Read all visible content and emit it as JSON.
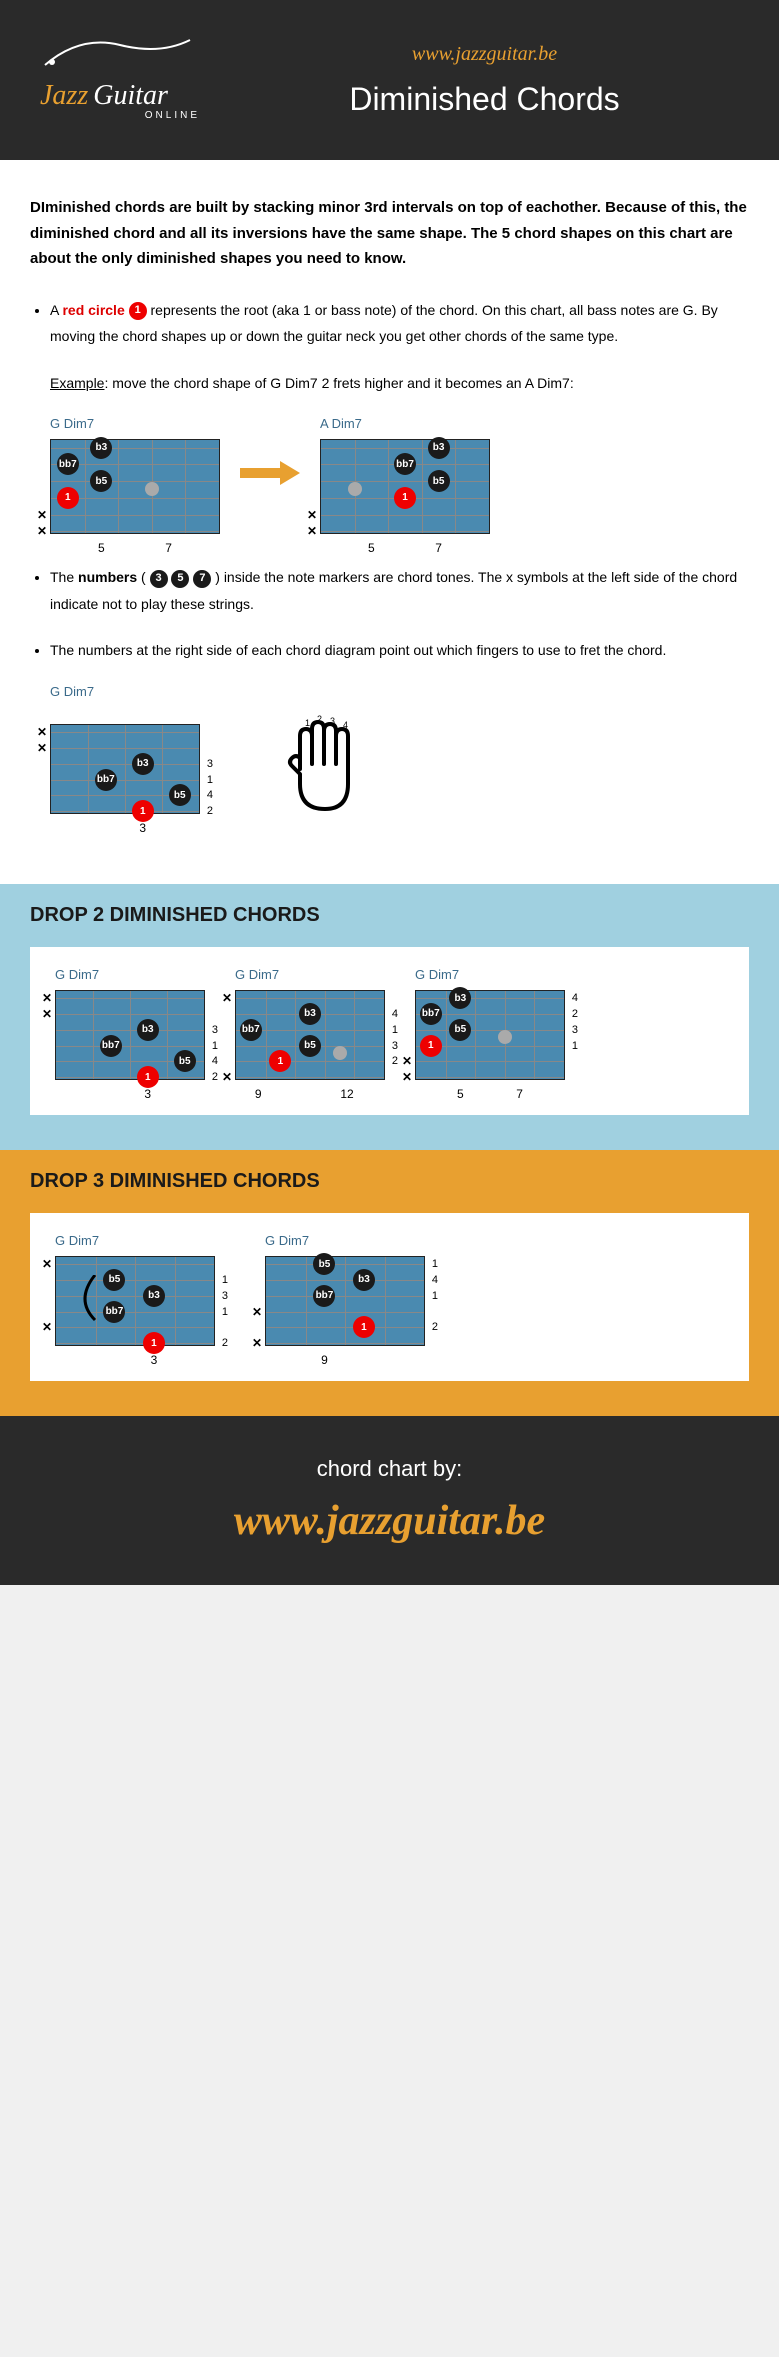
{
  "header": {
    "url": "www.jazzguitar.be",
    "title": "Diminished Chords",
    "logo_jazz": "Jazz",
    "logo_guitar": "Guitar",
    "logo_sub": "ONLINE"
  },
  "intro": "DIminished chords are built by stacking minor 3rd intervals on top of eachother. Because of this, the diminished chord and all its inversions have the same shape. The 5 chord shapes on this chart are about the only diminished shapes you need to know.",
  "bullet1_a": "A ",
  "bullet1_red": "red circle",
  "bullet1_b": " represents the root (aka 1 or bass note) of the chord. On this chart, all bass notes are G. By moving the chord shapes up or down the guitar neck you get other chords of the same type.",
  "example_label": "Example",
  "example_text": ": move the chord shape of G Dim7 2 frets higher and it becomes an A Dim7:",
  "diagram1_label": "G Dim7",
  "diagram2_label": "A Dim7",
  "bullet2_a": "The ",
  "bullet2_bold": "numbers",
  "bullet2_b": " ( ",
  "bullet2_c": " ) inside the note markers are chord tones. The x symbols at the left side of the chord indicate not to play these strings.",
  "bullet3": "The numbers at the right side of each chord diagram point out which fingers to use to fret the chord.",
  "diagram3_label": "G Dim7",
  "section1_title": "DROP 2 DIMINISHED CHORDS",
  "section1_chords": [
    "G Dim7",
    "G Dim7",
    "G Dim7"
  ],
  "section2_title": "DROP 3 DIMINISHED CHORDS",
  "section2_chords": [
    "G Dim7",
    "G Dim7"
  ],
  "footer_label": "chord chart by:",
  "footer_url": "www.jazzguitar.be",
  "tones": {
    "one": "1",
    "b3": "b3",
    "b5": "b5",
    "bb7": "bb7",
    "three": "3",
    "five": "5",
    "seven": "7"
  },
  "frets": {
    "f3": "3",
    "f5": "5",
    "f7": "7",
    "f9": "9",
    "f12": "12"
  },
  "fingers": {
    "f1": "1",
    "f2": "2",
    "f3": "3",
    "f4": "4"
  },
  "hand_labels": [
    "1",
    "2",
    "3",
    "4"
  ]
}
